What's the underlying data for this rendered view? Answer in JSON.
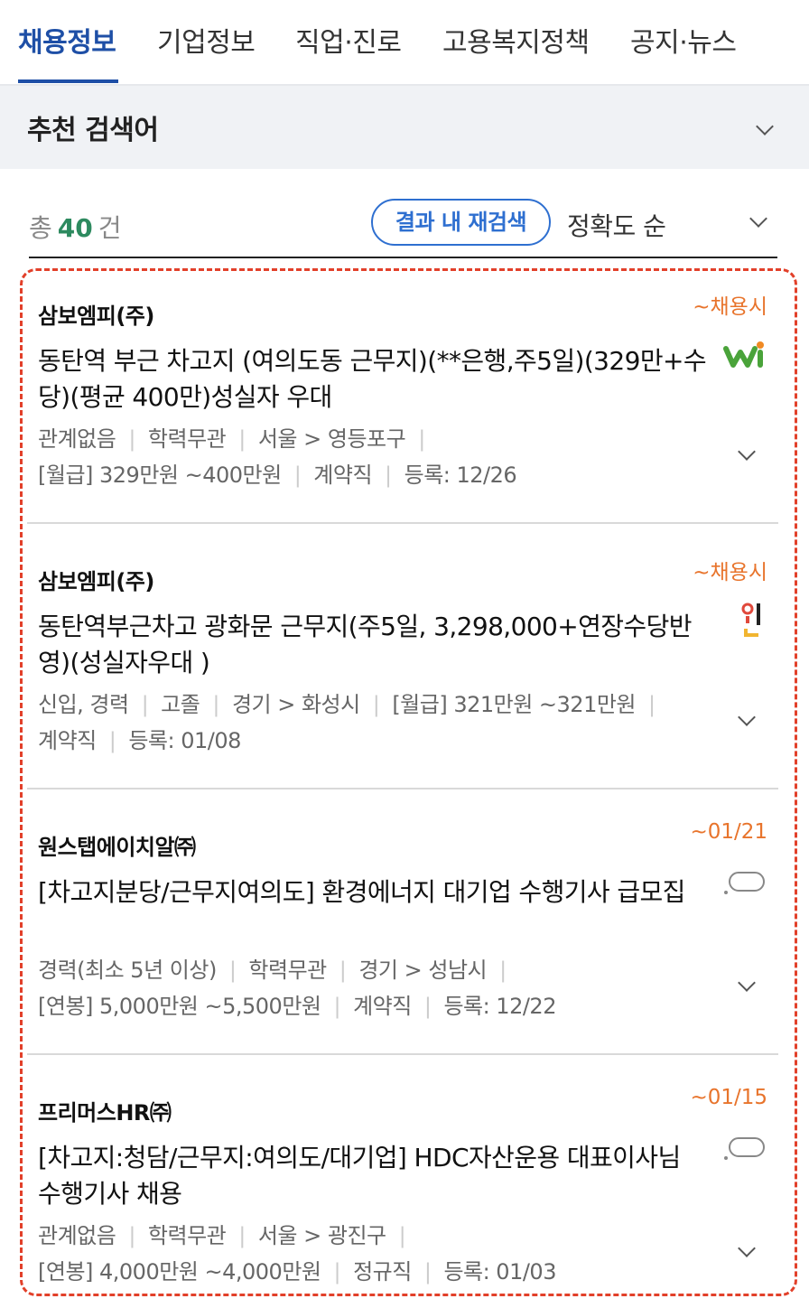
{
  "tabs": [
    {
      "label": "채용정보",
      "active": true
    },
    {
      "label": "기업정보",
      "active": false
    },
    {
      "label": "직업·진로",
      "active": false
    },
    {
      "label": "고용복지정책",
      "active": false
    },
    {
      "label": "공지·뉴스",
      "active": false
    }
  ],
  "recommend": {
    "title": "추천 검색어",
    "icon": "chevron-down-icon"
  },
  "results": {
    "prefix": "총",
    "count": "40",
    "suffix": "건",
    "research_label": "결과 내 재검색",
    "sort_label": "정확도 순"
  },
  "jobs": [
    {
      "company": "삼보엠피(주)",
      "deadline": "~채용시",
      "title": "동탄역 부근 차고지 (여의도동 근무지)(**은행,주5일)(329만+수당)(평균 400만)성실자 우대",
      "logo": "worknet-logo-icon",
      "meta1": [
        "관계없음",
        "학력무관",
        "서울 > 영등포구"
      ],
      "meta2": [
        "[월급] 329만원 ~400만원",
        "계약직",
        "등록: 12/26"
      ]
    },
    {
      "company": "삼보엠피(주)",
      "deadline": "~채용시",
      "title": "동탄역부근차고 광화문 근무지(주5일, 3,298,000+연장수당반영)(성실자우대 )",
      "logo": "saramin-logo-icon",
      "meta1": [
        "신입, 경력",
        "고졸",
        "경기 > 화성시",
        "[월급] 321만원 ~321만원"
      ],
      "meta2": [
        "계약직",
        "등록: 01/08"
      ]
    },
    {
      "company": "원스탭에이치알㈜",
      "deadline": "~01/21",
      "title": "[차고지분당/근무지여의도] 환경에너지 대기업 수행기사 급모집",
      "logo": "speech-bubble-logo-icon",
      "meta1": [
        "경력(최소 5년 이상)",
        "학력무관",
        "경기 > 성남시"
      ],
      "meta2": [
        "[연봉] 5,000만원 ~5,500만원",
        "계약직",
        "등록: 12/22"
      ]
    },
    {
      "company": "프리머스HR㈜",
      "deadline": "~01/15",
      "title": "[차고지:청담/근무지:여의도/대기업] HDC자산운용 대표이사님 수행기사 채용",
      "logo": "speech-bubble-logo-icon",
      "meta1": [
        "관계없음",
        "학력무관",
        "서울 > 광진구"
      ],
      "meta2": [
        "[연봉] 4,000만원 ~4,000만원",
        "정규직",
        "등록: 01/03"
      ]
    }
  ],
  "colors": {
    "accent": "#1e4fa6",
    "deadline": "#e8742c",
    "count": "#2d8a5f",
    "highlight": "#e2402a"
  }
}
